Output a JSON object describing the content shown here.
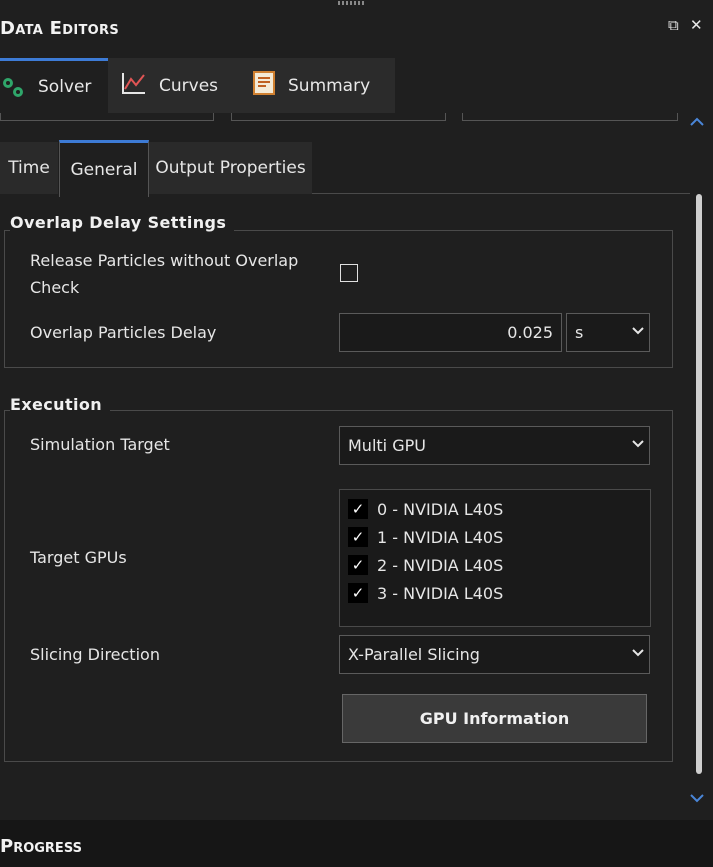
{
  "panel": {
    "title": "Data Editors",
    "restore_icon": "⧉",
    "close_icon": "✕"
  },
  "top_tabs": [
    {
      "label": "Solver",
      "icon": "gears-icon",
      "active": true
    },
    {
      "label": "Curves",
      "icon": "line-chart-icon",
      "active": false
    },
    {
      "label": "Summary",
      "icon": "document-icon",
      "active": false
    }
  ],
  "sub_tabs": [
    {
      "label": "Time",
      "active": false
    },
    {
      "label": "General",
      "active": true
    },
    {
      "label": "Output Properties",
      "active": false
    }
  ],
  "overlap_group": {
    "title": "Overlap Delay Settings",
    "release_label": "Release Particles without Overlap Check",
    "release_checked": false,
    "delay_label": "Overlap Particles Delay",
    "delay_value": "0.025",
    "delay_unit": "s"
  },
  "execution_group": {
    "title": "Execution",
    "sim_target_label": "Simulation Target",
    "sim_target_value": "Multi GPU",
    "target_gpus_label": "Target GPUs",
    "gpus": [
      {
        "label": "0 - NVIDIA L40S",
        "checked": true
      },
      {
        "label": "1 - NVIDIA L40S",
        "checked": true
      },
      {
        "label": "2 - NVIDIA L40S",
        "checked": true
      },
      {
        "label": "3 - NVIDIA L40S",
        "checked": true
      }
    ],
    "slicing_label": "Slicing Direction",
    "slicing_value": "X-Parallel Slicing",
    "gpu_info_button": "GPU Information"
  },
  "glyphs": {
    "checkmark": "✓",
    "chevron": "⌄",
    "scroll_up": "︿",
    "scroll_down": "﹀"
  },
  "colors": {
    "accent": "#3d7bd6",
    "background": "#1f1f1f",
    "scroll_arrow": "#4a86d8"
  },
  "bottom_panel": {
    "title": "Progress"
  }
}
